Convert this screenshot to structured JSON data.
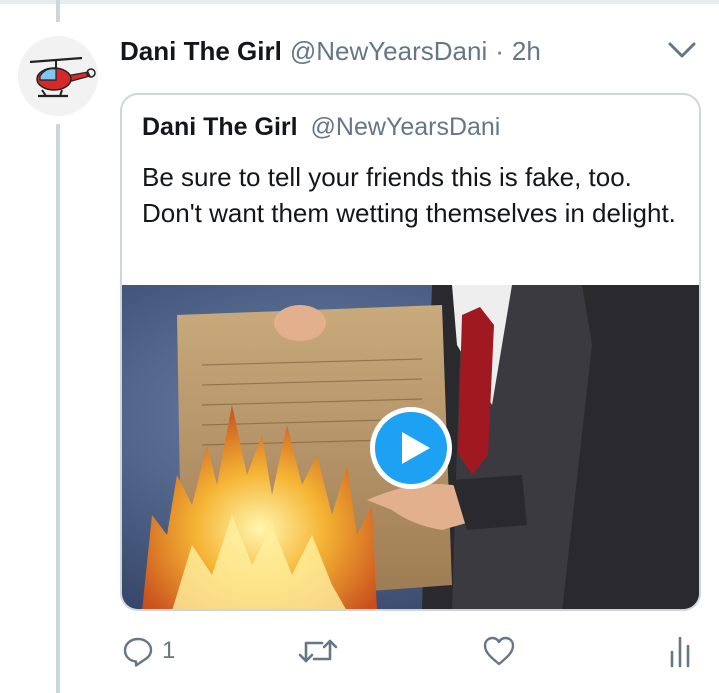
{
  "tweet": {
    "author_name": "Dani The Girl",
    "author_handle": "@NewYearsDani",
    "separator": "·",
    "time": "2h",
    "avatar_icon": "helicopter-icon"
  },
  "quoted_tweet": {
    "author_name": "Dani The Girl",
    "author_handle": "@NewYearsDani",
    "text": "Be sure to tell your friends this is fake, too. Don't want them wetting themselves in delight.",
    "media": {
      "type": "video",
      "play_icon": "play-icon"
    }
  },
  "actions": {
    "reply_count": "1",
    "reply_icon": "reply-icon",
    "retweet_icon": "retweet-icon",
    "like_icon": "heart-icon",
    "analytics_icon": "analytics-icon"
  },
  "colors": {
    "accent": "#1da1f2",
    "text": "#14171a",
    "secondary": "#657786",
    "border": "#ccd6dd"
  }
}
